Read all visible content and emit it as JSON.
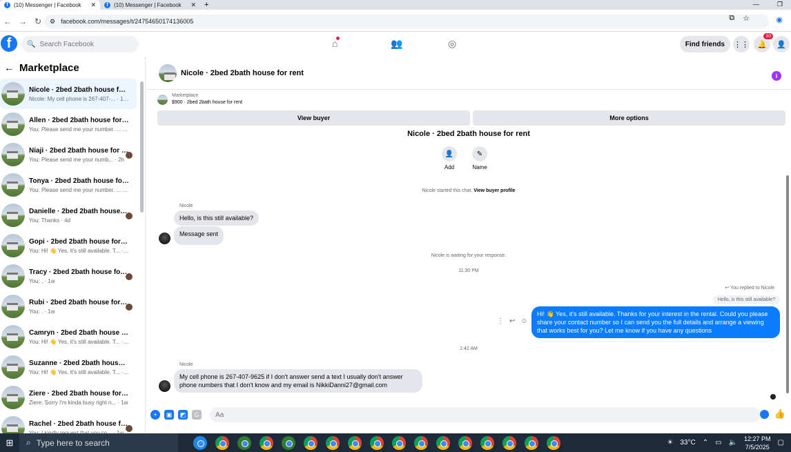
{
  "browser": {
    "tabs": [
      {
        "label": "(10) Messenger | Facebook",
        "active": true
      },
      {
        "label": "(10) Messenger | Facebook",
        "active": false
      }
    ],
    "url": "facebook.com/messages/t/24754650174136005"
  },
  "fb_nav": {
    "search_placeholder": "Search Facebook",
    "find_friends": "Find friends",
    "notif_count": "10",
    "brand_color": "#1877f2"
  },
  "sidebar": {
    "title": "Marketplace",
    "conversations": [
      {
        "name": "Nicole · 2bed 2bath house for re...",
        "preview": "Nicole: My cell phone is 267-407-... · 10m"
      },
      {
        "name": "Allen · 2bed 2bath house for rent",
        "preview": "You: Please send me your number. ... · 2h"
      },
      {
        "name": "Niaji · 2bed 2bath house for r...",
        "preview": "You: Please send me your numb... · 2h"
      },
      {
        "name": "Tonya · 2bed 2bath house for rent",
        "preview": "You: Please send me your number. ... · 2h"
      },
      {
        "name": "Danielle · 2bed 2bath house f...",
        "preview": "You: Thanks · 4d"
      },
      {
        "name": "Gopi · 2bed 2bath house for rent",
        "preview": "You: Hi! 👋 Yes, it's still available. T... · 4d"
      },
      {
        "name": "Tracy · 2bed 2bath house for r...",
        "preview": "You: , · 1w"
      },
      {
        "name": "Rubi · 2bed 2bath house for r...",
        "preview": "You: . · 1w"
      },
      {
        "name": "Camryn · 2bed 2bath house for ...",
        "preview": "You: Hi! 👋 Yes, it's still available. T... · 1w"
      },
      {
        "name": "Suzanne · 2bed 2bath house for ...",
        "preview": "You: Hi! 👋 Yes, it's still available. T... · 1w"
      },
      {
        "name": "Ziere · 2bed 2bath house for rent",
        "preview": "Ziere: Sorry I'm kinda busy right n... · 1w"
      },
      {
        "name": "Rachel · 2bed 2bath house for...",
        "preview": "You: I kindly request that you co... · 1w"
      }
    ]
  },
  "chat": {
    "header_title": "Nicole · 2bed 2bath house for rent",
    "marketplace_label": "Marketplace",
    "listing": "$900 · 2bed 2bath house for rent",
    "view_buyer": "View buyer",
    "more_options": "More options",
    "conv_title": "Nicole · 2bed 2bath house for rent",
    "add_label": "Add",
    "name_label": "Name",
    "started_text": "Nicole started this chat.",
    "view_profile": "View buyer profile",
    "sender1": "Nicole",
    "msg1": "Hello, is this still available?",
    "msg2": "Message sent",
    "waiting": "Nicole is waiting for your response.",
    "time1": "11:30 PM",
    "replied_to": "You replied to Nicole",
    "replied_quote": "Hello, is this still available?",
    "my_msg": "Hi! 👋 Yes, it's still available. Thanks for your interest in the rental. Could you please share your contact number so I can send you the full details and arrange a viewing that works best for you? Let me know if you have any questions",
    "time2": "1:42 AM",
    "sender2": "Nicole",
    "msg3": "My cell phone is 267-407-9625 if I don't answer send a text I usually don't answer phone numbers that I don't know and my email is NikkiDanni27@gmail.com",
    "composer_placeholder": "Aa",
    "outgoing_color": "#0a7cff"
  },
  "taskbar": {
    "search_placeholder": "Type here to search",
    "temperature": "33°C",
    "time": "12:27 PM",
    "date": "7/5/2025"
  }
}
